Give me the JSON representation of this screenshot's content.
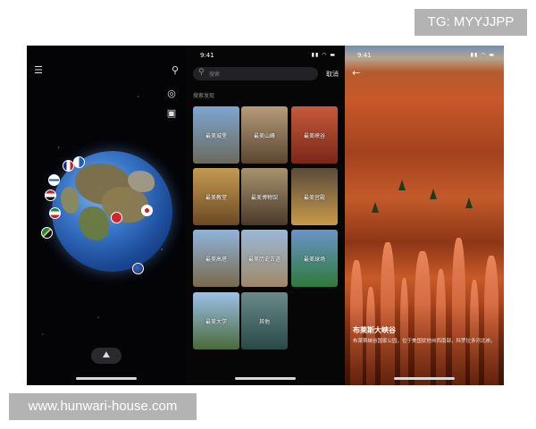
{
  "watermarks": {
    "top": "TG: MYYJJPP",
    "bottom": "www.hunwari-house.com"
  },
  "globe_screen": {
    "icons": {
      "menu": "menu-icon",
      "search": "search-icon",
      "compass": "compass-icon",
      "gallery": "gallery-icon",
      "bottom": "mode-icon"
    },
    "menu_glyph": "☰",
    "search_glyph": "⚲",
    "compass_glyph": "◎",
    "gallery_glyph": "▣",
    "bottom_glyph": "⛰"
  },
  "search_screen": {
    "status_time": "9:41",
    "status_icons": "▮▮ ◠ ▬",
    "search_placeholder": "搜索",
    "cancel_label": "取消",
    "section_title": "搜索发现",
    "tiles": [
      {
        "label": "最美城堡",
        "color_top": "#7ea6d1",
        "color_bottom": "#6b6a5c"
      },
      {
        "label": "最美山峰",
        "color_top": "#b59b7a",
        "color_bottom": "#5a4630"
      },
      {
        "label": "最美峡谷",
        "color_top": "#c55a3a",
        "color_bottom": "#7a2718"
      },
      {
        "label": "最美教堂",
        "color_top": "#c49a52",
        "color_bottom": "#6b4a22"
      },
      {
        "label": "最美博物馆",
        "color_top": "#a8926e",
        "color_bottom": "#4a3a2a"
      },
      {
        "label": "最美宫殿",
        "color_top": "#5a4a3a",
        "color_bottom": "#c89a4a"
      },
      {
        "label": "最美高塔",
        "color_top": "#8fb4dc",
        "color_bottom": "#7a6a4a"
      },
      {
        "label": "最美历史古迹",
        "color_top": "#9ab8d8",
        "color_bottom": "#a08866"
      },
      {
        "label": "最美球场",
        "color_top": "#6a94c8",
        "color_bottom": "#2f7a3a"
      },
      {
        "label": "最美大学",
        "color_top": "#9cc0e8",
        "color_bottom": "#4a6a3a"
      },
      {
        "label": "其他",
        "color_top": "#6a8a8a",
        "color_bottom": "#2a4a4a"
      }
    ]
  },
  "detail_screen": {
    "status_time": "9:41",
    "status_icons": "▮▮ ◠ ▬",
    "back_glyph": "←",
    "title": "布莱斯大峡谷",
    "description": "布莱斯峡谷国家公园，位于美国犹他州西南部，科罗拉多河北岸。"
  }
}
